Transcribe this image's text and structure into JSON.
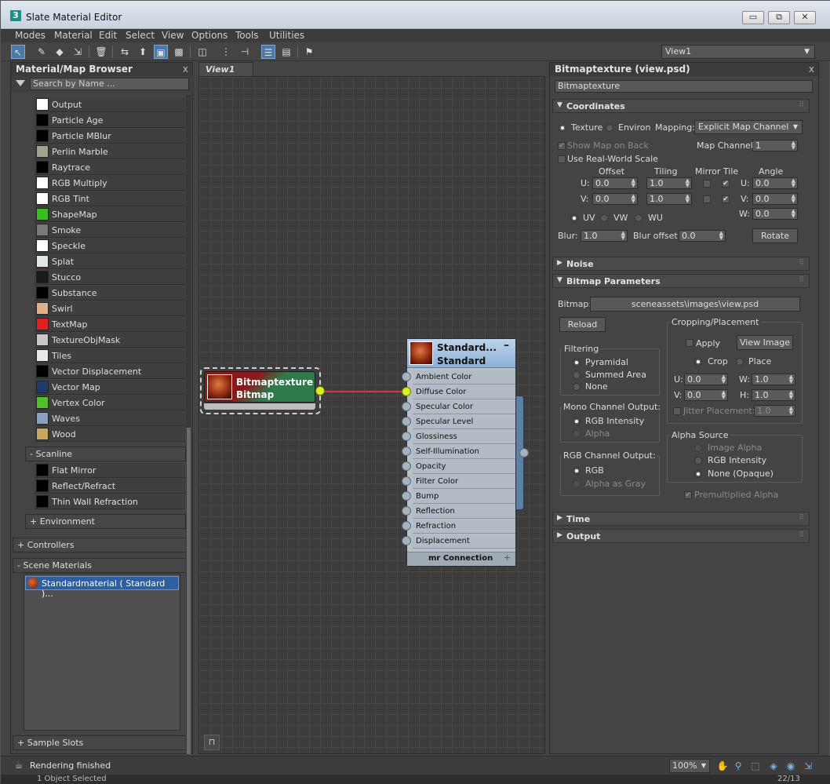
{
  "window": {
    "title": "Slate Material Editor",
    "app_icon": "3",
    "minimize": "▭",
    "restore": "⧉",
    "close": "✕"
  },
  "menu": [
    "Modes",
    "Material",
    "Edit",
    "Select",
    "View",
    "Options",
    "Tools",
    "Utilities"
  ],
  "toolbar": {
    "view_selector": "View1",
    "icons": [
      "select-arrow-icon",
      "eyedropper-icon",
      "pick-material-icon",
      "assign-material-icon",
      "delete-icon",
      "move-children-icon",
      "show-material-icon",
      "show-map-icon",
      "background-icon",
      "layout-icon",
      "layout-children-icon",
      "hide-slots-icon",
      "show-all-icon",
      "material-map-browser-icon",
      "parameter-editor-icon",
      "select-by-material-icon"
    ]
  },
  "browser": {
    "title": "Material/Map Browser",
    "close": "x",
    "search_placeholder": "Search by Name ...",
    "maps": [
      {
        "label": "Output",
        "swatch": "#ffffff"
      },
      {
        "label": "Particle Age",
        "swatch": "#000000"
      },
      {
        "label": "Particle MBlur",
        "swatch": "#000000"
      },
      {
        "label": "Perlin Marble",
        "swatch": "#9aa58c"
      },
      {
        "label": "Raytrace",
        "swatch": "#000000"
      },
      {
        "label": "RGB Multiply",
        "swatch": "#ffffff"
      },
      {
        "label": "RGB Tint",
        "swatch": "#ffffff"
      },
      {
        "label": "ShapeMap",
        "swatch": "#38c022"
      },
      {
        "label": "Smoke",
        "swatch": "#7a7a7a"
      },
      {
        "label": "Speckle",
        "swatch": "#ffffff"
      },
      {
        "label": "Splat",
        "swatch": "#dfe7ea"
      },
      {
        "label": "Stucco",
        "swatch": "#1a1a1a"
      },
      {
        "label": "Substance",
        "swatch": "#000000"
      },
      {
        "label": "Swirl",
        "swatch": "#e0b088"
      },
      {
        "label": "TextMap",
        "swatch": "#e02020"
      },
      {
        "label": "TextureObjMask",
        "swatch": "#c8c8c8"
      },
      {
        "label": "Tiles",
        "swatch": "#e8e8e8"
      },
      {
        "label": "Vector Displacement",
        "swatch": "#000000"
      },
      {
        "label": "Vector Map",
        "swatch": "#203a6a"
      },
      {
        "label": "Vertex Color",
        "swatch": "#50c030"
      },
      {
        "label": "Waves",
        "swatch": "#8aa0c0"
      },
      {
        "label": "Wood",
        "swatch": "#c8a860"
      }
    ],
    "scanline_group": "- Scanline",
    "scanline_items": [
      "Flat Mirror",
      "Reflect/Refract",
      "Thin Wall Refraction"
    ],
    "environment_group": "+ Environment",
    "controllers": "+ Controllers",
    "scene_materials": "- Scene Materials",
    "scene_item": "Standardmaterial  ( Standard )...",
    "sample_slots": "+ Sample Slots"
  },
  "view": {
    "tab": "View1",
    "bitmap_node": {
      "title": "Bitmaptexture",
      "subtitle": "Bitmap"
    },
    "standard_node": {
      "title": "Standard...",
      "subtitle": "Standard",
      "minus": "–",
      "slots": [
        "Ambient Color",
        "Diffuse Color",
        "Specular Color",
        "Specular Level",
        "Glossiness",
        "Self-Illumination",
        "Opacity",
        "Filter Color",
        "Bump",
        "Reflection",
        "Refraction",
        "Displacement"
      ],
      "footer": "mr Connection",
      "footer_plus": "+"
    }
  },
  "params": {
    "title": "Bitmaptexture (view.psd)",
    "close": "x",
    "name": "Bitmaptexture",
    "coordinates": {
      "header": "Coordinates",
      "texture": "Texture",
      "environ": "Environ",
      "mapping_label": "Mapping:",
      "mapping_value": "Explicit Map Channel",
      "show_map_on_back": "Show Map on Back",
      "map_channel_label": "Map Channel:",
      "map_channel": "1",
      "use_real_world": "Use Real-World Scale",
      "offset": "Offset",
      "tiling": "Tiling",
      "mirror_tile": "Mirror Tile",
      "angle": "Angle",
      "u_label": "U:",
      "v_label": "V:",
      "w_label": "W:",
      "u_offset": "0.0",
      "v_offset": "0.0",
      "u_tiling": "1.0",
      "v_tiling": "1.0",
      "u_angle": "0.0",
      "v_angle": "0.0",
      "w_angle": "0.0",
      "uv": "UV",
      "vw": "VW",
      "wu": "WU",
      "blur_label": "Blur:",
      "blur": "1.0",
      "blur_offset_label": "Blur offset:",
      "blur_offset": "0.0",
      "rotate": "Rotate",
      "check": "✔"
    },
    "noise": "Noise",
    "bitmap_params": {
      "header": "Bitmap Parameters",
      "bitmap_label": "Bitmap:",
      "bitmap_path": "sceneassets\\images\\view.psd",
      "reload": "Reload",
      "cropping": "Cropping/Placement",
      "apply": "Apply",
      "view_image": "View Image",
      "crop": "Crop",
      "place": "Place",
      "u_label": "U:",
      "v_label": "V:",
      "w_label": "W:",
      "h_label": "H:",
      "u": "0.0",
      "v": "0.0",
      "w": "1.0",
      "h": "1.0",
      "jitter_label": "Jitter Placement:",
      "jitter": "1.0",
      "filtering": "Filtering",
      "pyramidal": "Pyramidal",
      "summed_area": "Summed Area",
      "none": "None",
      "mono_output": "Mono Channel Output:",
      "rgb_intensity": "RGB Intensity",
      "alpha": "Alpha",
      "rgb_output": "RGB Channel Output:",
      "rgb": "RGB",
      "alpha_as_gray": "Alpha as Gray",
      "alpha_source": "Alpha Source",
      "image_alpha": "Image Alpha",
      "rgb_intensity2": "RGB Intensity",
      "none_opaque": "None (Opaque)",
      "premultiplied": "Premultiplied Alpha",
      "check": "✔"
    },
    "time": "Time",
    "output": "Output",
    "expanded_glyph": "▼",
    "collapsed_glyph": "▶",
    "grip": "⠿"
  },
  "status": {
    "message": "Rendering finished",
    "zoom": "100%",
    "below": "1 Object Selected",
    "below_right": "22/13"
  }
}
